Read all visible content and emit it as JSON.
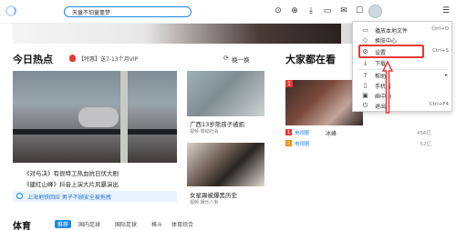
{
  "header": {
    "search_value": "天童不怕童噩梦",
    "icons": [
      "history-icon",
      "theater-icon",
      "download-icon",
      "tv-icon",
      "mail-icon",
      "avatar",
      "menu-icon"
    ]
  },
  "hot": {
    "title": "今日热点",
    "promo": "【特惠】送7-13个月VIP",
    "change": "换一换",
    "items": [
      {
        "title": "广西13岁熊孩子被抓",
        "sub": "视频·感动社会"
      },
      {
        "title": "女星踢被爆黑历史",
        "sub": "视频·娱乐八卦"
      }
    ],
    "main_caption_1": "《对与决》有很特工热血抗日伏大剧",
    "main_caption_2": "《建红山峰》抖音上演大片风暴演出",
    "info_text": "上海地铁回应 男子不顾安全被拖拽"
  },
  "watching": {
    "title": "大家都在看",
    "ranks": [
      {
        "num": "1",
        "tag": "电视剧",
        "title": "冰峰",
        "count": "456亿",
        "color": "#e53935"
      },
      {
        "num": "2",
        "tag": "电视剧",
        "title": "",
        "count": "52亿",
        "color": "#fb8c00"
      }
    ]
  },
  "bottom": {
    "title": "体育",
    "tabs": [
      "推荐",
      "国内足球",
      "国际足球",
      "格斗",
      "体育综合"
    ]
  },
  "menu": {
    "items": [
      {
        "icon": "folder-icon",
        "label": "播放本地文件",
        "shortcut": "Ctrl+O"
      },
      {
        "icon": "skin-icon",
        "label": "换肤中心",
        "shortcut": ""
      },
      {
        "icon": "gear-icon",
        "label": "设置",
        "shortcut": "Ctrl+S"
      },
      {
        "icon": "download-icon",
        "label": "下载",
        "shortcut": ""
      },
      {
        "icon": "help-icon",
        "label": "帮助",
        "shortcut": "",
        "submenu": true
      },
      {
        "icon": "phone-icon",
        "label": "手机看",
        "shortcut": ""
      },
      {
        "icon": "pip-icon",
        "label": "画中画",
        "shortcut": ""
      },
      {
        "icon": "exit-icon",
        "label": "退出",
        "shortcut": "Ctrl+F4"
      }
    ]
  },
  "colors": {
    "accent": "#1e88e5",
    "highlight": "#e53935"
  }
}
